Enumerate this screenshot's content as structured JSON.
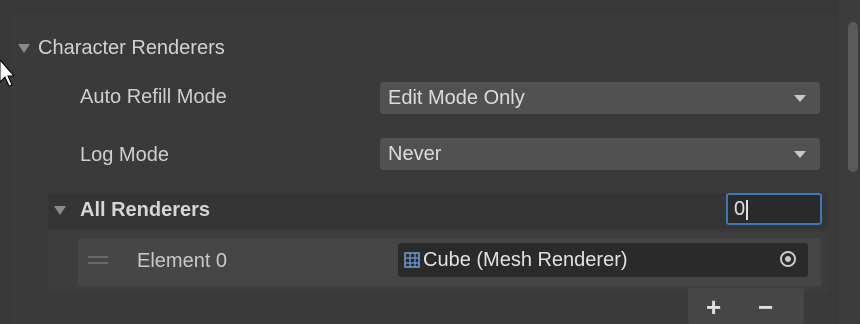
{
  "section": {
    "title": "Character Renderers"
  },
  "fields": [
    {
      "label": "Auto Refill Mode",
      "value": "Edit Mode Only"
    },
    {
      "label": "Log Mode",
      "value": "Never"
    }
  ],
  "renderers_list": {
    "title": "All Renderers",
    "count": "0",
    "elements": [
      {
        "label": "Element 0",
        "value": "Cube (Mesh Renderer)"
      }
    ],
    "add_label": "+",
    "remove_label": "−"
  },
  "colors": {
    "focus_border": "#3a79bb",
    "panel_bg": "#383838"
  }
}
